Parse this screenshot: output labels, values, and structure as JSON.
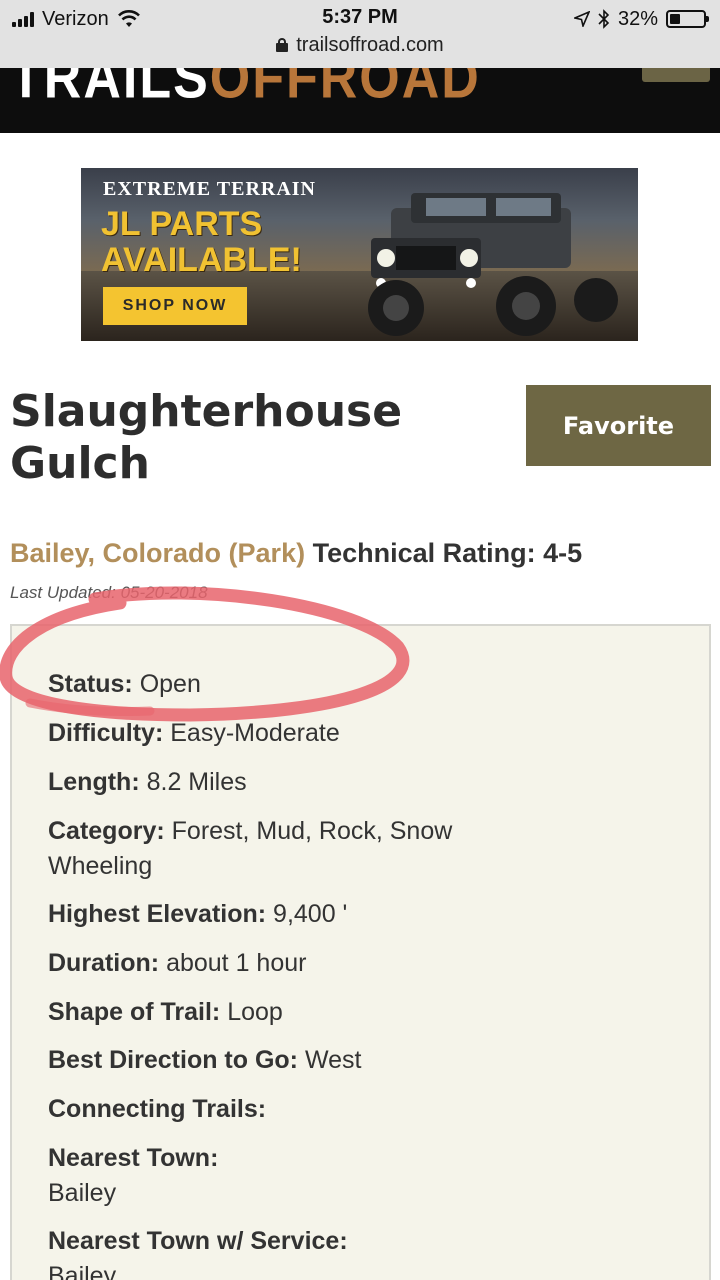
{
  "status_bar": {
    "carrier": "Verizon",
    "time": "5:37 PM",
    "battery": "32%",
    "battery_level": 0.32,
    "url": "trailsoffroad.com"
  },
  "site": {
    "logo_part1": "TRAILS",
    "logo_part2": "OFFROAD"
  },
  "ad": {
    "brand": "EXTREME TERRAIN",
    "headline_1": "JL PARTS",
    "headline_2": "AVAILABLE!",
    "cta": "SHOP NOW"
  },
  "trail": {
    "title": "Slaughterhouse Gulch",
    "favorite_label": "Favorite",
    "location": "Bailey, Colorado (Park)",
    "technical_rating": "Technical Rating: 4-5",
    "last_updated": "Last Updated: 05-20-2018"
  },
  "details": [
    {
      "label": "Status:",
      "value": "Open"
    },
    {
      "label": "Difficulty:",
      "value": "Easy-Moderate"
    },
    {
      "label": "Length:",
      "value": "8.2 Miles"
    },
    {
      "label": "Category:",
      "value": "Forest, Mud, Rock, Snow Wheeling"
    },
    {
      "label": "Highest Elevation:",
      "value": "9,400 '"
    },
    {
      "label": "Duration:",
      "value": "about 1 hour"
    },
    {
      "label": "Shape of Trail:",
      "value": "Loop"
    },
    {
      "label": "Best Direction to Go:",
      "value": "West"
    },
    {
      "label": "Connecting Trails:",
      "value": ""
    },
    {
      "label": "Nearest Town:",
      "value": "Bailey"
    },
    {
      "label": "Nearest Town w/ Service:",
      "value": "Bailey"
    }
  ],
  "colors": {
    "accent_olive": "#6e6744",
    "location_tan": "#b28f5b",
    "annotation_red": "#e8646c"
  }
}
